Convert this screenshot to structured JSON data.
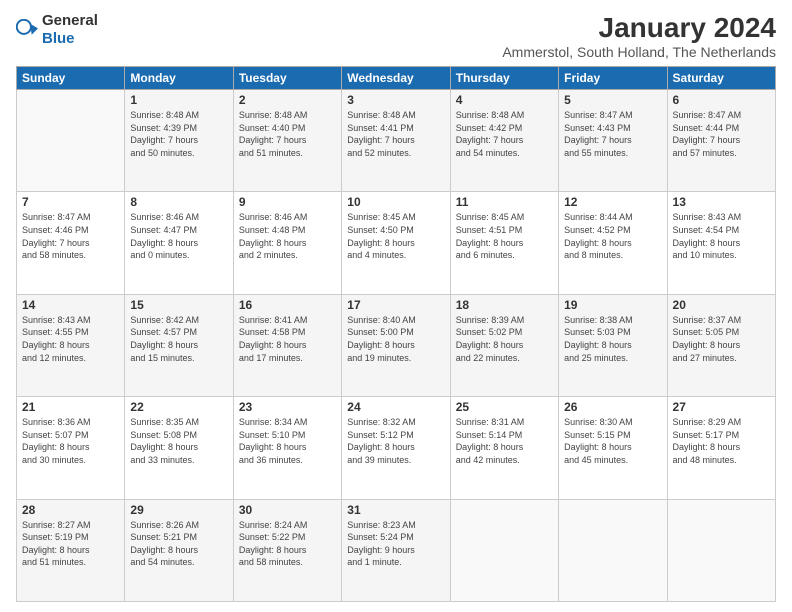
{
  "header": {
    "logo_general": "General",
    "logo_blue": "Blue",
    "title": "January 2024",
    "subtitle": "Ammerstol, South Holland, The Netherlands"
  },
  "days_of_week": [
    "Sunday",
    "Monday",
    "Tuesday",
    "Wednesday",
    "Thursday",
    "Friday",
    "Saturday"
  ],
  "weeks": [
    [
      {
        "day": "",
        "content": ""
      },
      {
        "day": "1",
        "content": "Sunrise: 8:48 AM\nSunset: 4:39 PM\nDaylight: 7 hours\nand 50 minutes."
      },
      {
        "day": "2",
        "content": "Sunrise: 8:48 AM\nSunset: 4:40 PM\nDaylight: 7 hours\nand 51 minutes."
      },
      {
        "day": "3",
        "content": "Sunrise: 8:48 AM\nSunset: 4:41 PM\nDaylight: 7 hours\nand 52 minutes."
      },
      {
        "day": "4",
        "content": "Sunrise: 8:48 AM\nSunset: 4:42 PM\nDaylight: 7 hours\nand 54 minutes."
      },
      {
        "day": "5",
        "content": "Sunrise: 8:47 AM\nSunset: 4:43 PM\nDaylight: 7 hours\nand 55 minutes."
      },
      {
        "day": "6",
        "content": "Sunrise: 8:47 AM\nSunset: 4:44 PM\nDaylight: 7 hours\nand 57 minutes."
      }
    ],
    [
      {
        "day": "7",
        "content": "Sunrise: 8:47 AM\nSunset: 4:46 PM\nDaylight: 7 hours\nand 58 minutes."
      },
      {
        "day": "8",
        "content": "Sunrise: 8:46 AM\nSunset: 4:47 PM\nDaylight: 8 hours\nand 0 minutes."
      },
      {
        "day": "9",
        "content": "Sunrise: 8:46 AM\nSunset: 4:48 PM\nDaylight: 8 hours\nand 2 minutes."
      },
      {
        "day": "10",
        "content": "Sunrise: 8:45 AM\nSunset: 4:50 PM\nDaylight: 8 hours\nand 4 minutes."
      },
      {
        "day": "11",
        "content": "Sunrise: 8:45 AM\nSunset: 4:51 PM\nDaylight: 8 hours\nand 6 minutes."
      },
      {
        "day": "12",
        "content": "Sunrise: 8:44 AM\nSunset: 4:52 PM\nDaylight: 8 hours\nand 8 minutes."
      },
      {
        "day": "13",
        "content": "Sunrise: 8:43 AM\nSunset: 4:54 PM\nDaylight: 8 hours\nand 10 minutes."
      }
    ],
    [
      {
        "day": "14",
        "content": "Sunrise: 8:43 AM\nSunset: 4:55 PM\nDaylight: 8 hours\nand 12 minutes."
      },
      {
        "day": "15",
        "content": "Sunrise: 8:42 AM\nSunset: 4:57 PM\nDaylight: 8 hours\nand 15 minutes."
      },
      {
        "day": "16",
        "content": "Sunrise: 8:41 AM\nSunset: 4:58 PM\nDaylight: 8 hours\nand 17 minutes."
      },
      {
        "day": "17",
        "content": "Sunrise: 8:40 AM\nSunset: 5:00 PM\nDaylight: 8 hours\nand 19 minutes."
      },
      {
        "day": "18",
        "content": "Sunrise: 8:39 AM\nSunset: 5:02 PM\nDaylight: 8 hours\nand 22 minutes."
      },
      {
        "day": "19",
        "content": "Sunrise: 8:38 AM\nSunset: 5:03 PM\nDaylight: 8 hours\nand 25 minutes."
      },
      {
        "day": "20",
        "content": "Sunrise: 8:37 AM\nSunset: 5:05 PM\nDaylight: 8 hours\nand 27 minutes."
      }
    ],
    [
      {
        "day": "21",
        "content": "Sunrise: 8:36 AM\nSunset: 5:07 PM\nDaylight: 8 hours\nand 30 minutes."
      },
      {
        "day": "22",
        "content": "Sunrise: 8:35 AM\nSunset: 5:08 PM\nDaylight: 8 hours\nand 33 minutes."
      },
      {
        "day": "23",
        "content": "Sunrise: 8:34 AM\nSunset: 5:10 PM\nDaylight: 8 hours\nand 36 minutes."
      },
      {
        "day": "24",
        "content": "Sunrise: 8:32 AM\nSunset: 5:12 PM\nDaylight: 8 hours\nand 39 minutes."
      },
      {
        "day": "25",
        "content": "Sunrise: 8:31 AM\nSunset: 5:14 PM\nDaylight: 8 hours\nand 42 minutes."
      },
      {
        "day": "26",
        "content": "Sunrise: 8:30 AM\nSunset: 5:15 PM\nDaylight: 8 hours\nand 45 minutes."
      },
      {
        "day": "27",
        "content": "Sunrise: 8:29 AM\nSunset: 5:17 PM\nDaylight: 8 hours\nand 48 minutes."
      }
    ],
    [
      {
        "day": "28",
        "content": "Sunrise: 8:27 AM\nSunset: 5:19 PM\nDaylight: 8 hours\nand 51 minutes."
      },
      {
        "day": "29",
        "content": "Sunrise: 8:26 AM\nSunset: 5:21 PM\nDaylight: 8 hours\nand 54 minutes."
      },
      {
        "day": "30",
        "content": "Sunrise: 8:24 AM\nSunset: 5:22 PM\nDaylight: 8 hours\nand 58 minutes."
      },
      {
        "day": "31",
        "content": "Sunrise: 8:23 AM\nSunset: 5:24 PM\nDaylight: 9 hours\nand 1 minute."
      },
      {
        "day": "",
        "content": ""
      },
      {
        "day": "",
        "content": ""
      },
      {
        "day": "",
        "content": ""
      }
    ]
  ]
}
